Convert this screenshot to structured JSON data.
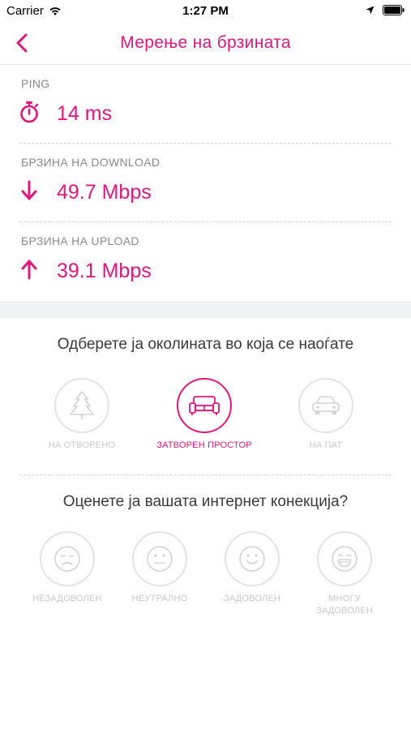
{
  "status_bar": {
    "carrier": "Carrier",
    "time": "1:27 PM"
  },
  "nav": {
    "title": "Мерење на брзината"
  },
  "results": [
    {
      "label": "PING",
      "value": "14 ms",
      "icon": "stopwatch-icon"
    },
    {
      "label": "БРЗИНА НА DOWNLOAD",
      "value": "49.7 Mbps",
      "icon": "arrow-down-icon"
    },
    {
      "label": "БРЗИНА НА UPLOAD",
      "value": "39.1 Mbps",
      "icon": "arrow-up-icon"
    }
  ],
  "environment": {
    "title": "Одберете ја околината во која се наоѓате",
    "options": [
      {
        "label": "НА ОТВОРЕНО",
        "icon": "tree-icon",
        "selected": false
      },
      {
        "label": "ЗАТВОРЕН ПРОСТОР",
        "icon": "sofa-icon",
        "selected": true
      },
      {
        "label": "НА ПАТ",
        "icon": "car-icon",
        "selected": false
      }
    ]
  },
  "rating": {
    "title": "Оценете ја вашата интернет конекција?",
    "options": [
      {
        "label": "НЕЗАДОВОЛЕН",
        "icon": "sad-face-icon"
      },
      {
        "label": "НЕУТРАЛНО",
        "icon": "neutral-face-icon"
      },
      {
        "label": "ЗАДОВОЛЕН",
        "icon": "smile-face-icon"
      },
      {
        "label_line1": "МНОГУ",
        "label_line2": "ЗАДОВОЛЕН",
        "icon": "laugh-face-icon"
      }
    ]
  },
  "colors": {
    "accent": "#e0167f",
    "inactive": "#c8c8c8"
  }
}
